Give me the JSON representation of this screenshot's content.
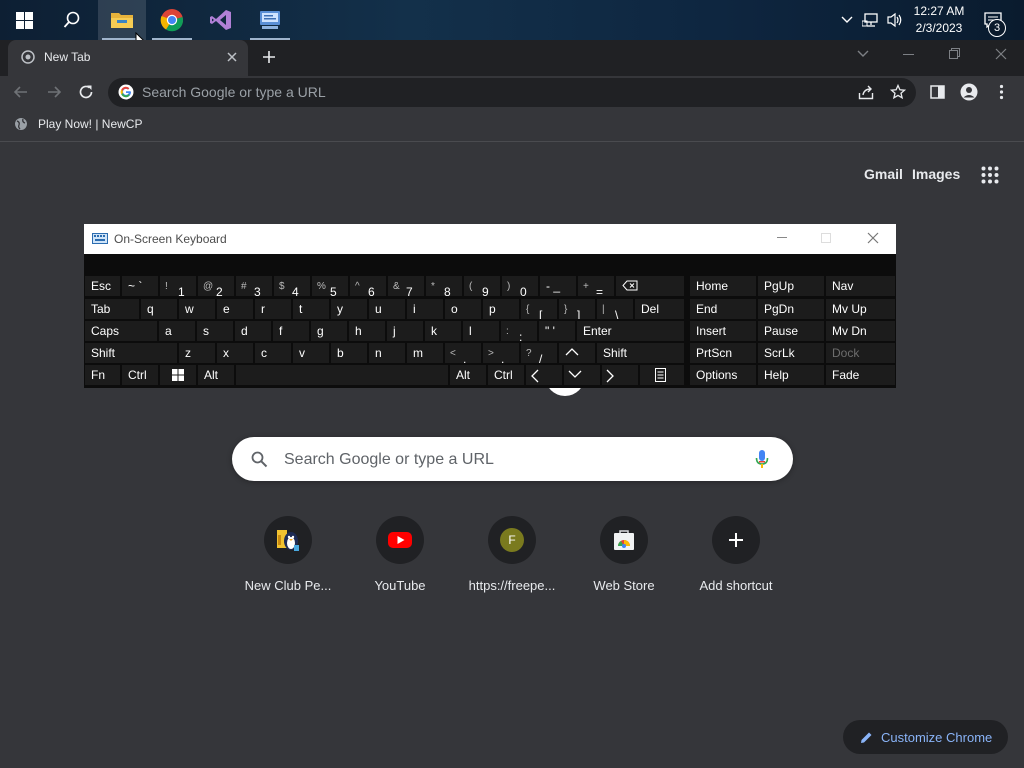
{
  "taskbar": {
    "apps": [
      "start-icon",
      "search-icon",
      "file-explorer-icon",
      "chrome-icon",
      "visual-studio-icon",
      "control-panel-icon"
    ],
    "clock_time": "12:27 AM",
    "clock_date": "2/3/2023",
    "notification_count": "3"
  },
  "browser": {
    "tab_title": "New Tab",
    "omnibox_placeholder": "Search Google or type a URL",
    "bookmark_label": "Play Now! | NewCP",
    "links": {
      "gmail": "Gmail",
      "images": "Images"
    },
    "search_placeholder": "Search Google or type a URL",
    "shortcuts": [
      {
        "label": "New Club Pe...",
        "icon": "penguin-icon"
      },
      {
        "label": "YouTube",
        "icon": "youtube-icon"
      },
      {
        "label": "https://freepe...",
        "icon": "letter-f-icon",
        "letter": "F"
      },
      {
        "label": "Web Store",
        "icon": "web-store-icon"
      },
      {
        "label": "Add shortcut",
        "icon": "plus-icon"
      }
    ],
    "customize_label": "Customize Chrome"
  },
  "osk": {
    "title": "On-Screen Keyboard",
    "row1": {
      "esc": "Esc",
      "tilde": "~ `",
      "k1s": "!",
      "k1": "1",
      "k2s": "@",
      "k2": "2",
      "k3s": "#",
      "k3": "3",
      "k4s": "$",
      "k4": "4",
      "k5s": "%",
      "k5": "5",
      "k6s": "^",
      "k6": "6",
      "k7s": "&",
      "k7": "7",
      "k8s": "*",
      "k8": "8",
      "k9s": "(",
      "k9": "9",
      "k0s": ")",
      "k0": "0",
      "minus": "- _",
      "plus": "+",
      "eq": "=",
      "home": "Home",
      "pgup": "PgUp",
      "nav": "Nav"
    },
    "row2": {
      "tab": "Tab",
      "q": "q",
      "w": "w",
      "e": "e",
      "r": "r",
      "t": "t",
      "y": "y",
      "u": "u",
      "i": "i",
      "o": "o",
      "p": "p",
      "lbs": "{",
      "lb": "[",
      "rbs": "}",
      "rb": "]",
      "bss": "|",
      "bs": "\\",
      "del": "Del",
      "end": "End",
      "pgdn": "PgDn",
      "mvup": "Mv Up"
    },
    "row3": {
      "caps": "Caps",
      "a": "a",
      "s": "s",
      "d": "d",
      "f": "f",
      "g": "g",
      "h": "h",
      "j": "j",
      "k": "k",
      "l": "l",
      "colon": ":",
      "semi": ";",
      "quote": "\" '",
      "enter": "Enter",
      "insert": "Insert",
      "pause": "Pause",
      "mvdn": "Mv Dn"
    },
    "row4": {
      "shift": "Shift",
      "z": "z",
      "x": "x",
      "c": "c",
      "v": "v",
      "b": "b",
      "n": "n",
      "m": "m",
      "lt": "<",
      "comma": ",",
      "gt": ">",
      "period": ".",
      "qm": "?",
      "slash": "/",
      "shift2": "Shift",
      "prtscn": "PrtScn",
      "scrlk": "ScrLk",
      "dock": "Dock"
    },
    "row5": {
      "fn": "Fn",
      "ctrl": "Ctrl",
      "alt": "Alt",
      "alt2": "Alt",
      "ctrl2": "Ctrl",
      "options": "Options",
      "help": "Help",
      "fade": "Fade"
    }
  },
  "colors": {
    "accent": "#8ab4f8",
    "background": "#35363a",
    "tabstrip": "#202124"
  }
}
